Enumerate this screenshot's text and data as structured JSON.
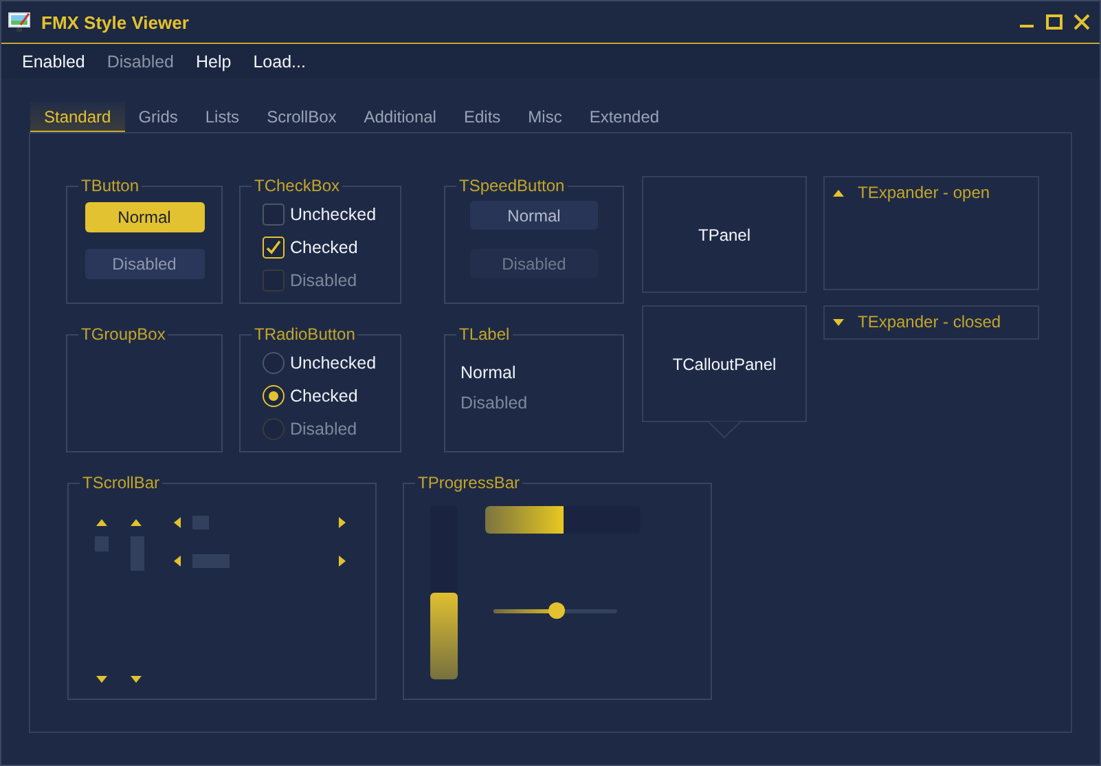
{
  "window": {
    "title": "FMX Style Viewer"
  },
  "menu": [
    {
      "label": "Enabled",
      "disabled": false
    },
    {
      "label": "Disabled",
      "disabled": true
    },
    {
      "label": "Help",
      "disabled": false
    },
    {
      "label": "Load...",
      "disabled": false
    }
  ],
  "tabs": [
    {
      "label": "Standard",
      "selected": true
    },
    {
      "label": "Grids",
      "selected": false
    },
    {
      "label": "Lists",
      "selected": false
    },
    {
      "label": "ScrollBox",
      "selected": false
    },
    {
      "label": "Additional",
      "selected": false
    },
    {
      "label": "Edits",
      "selected": false
    },
    {
      "label": "Misc",
      "selected": false
    },
    {
      "label": "Extended",
      "selected": false
    }
  ],
  "groups": [
    {
      "kind": "buttons",
      "title": "TButton",
      "items": [
        {
          "label": "Normal",
          "disabled": false
        },
        {
          "label": "Disabled",
          "disabled": true
        }
      ]
    },
    {
      "kind": "checkboxes",
      "title": "TCheckBox",
      "items": [
        {
          "label": "Unchecked",
          "checked": false,
          "disabled": false
        },
        {
          "label": "Checked",
          "checked": true,
          "disabled": false
        },
        {
          "label": "Disabled",
          "checked": false,
          "disabled": true
        }
      ]
    },
    {
      "kind": "speedbuttons",
      "title": "TSpeedButton",
      "items": [
        {
          "label": "Normal",
          "disabled": false
        },
        {
          "label": "Disabled",
          "disabled": true
        }
      ]
    },
    {
      "kind": "empty",
      "title": "TGroupBox"
    },
    {
      "kind": "radios",
      "title": "TRadioButton",
      "items": [
        {
          "label": "Unchecked",
          "selected": false,
          "disabled": false
        },
        {
          "label": "Checked",
          "selected": true,
          "disabled": false
        },
        {
          "label": "Disabled",
          "selected": false,
          "disabled": true
        }
      ]
    },
    {
      "kind": "labels",
      "title": "TLabel",
      "items": [
        {
          "label": "Normal",
          "disabled": false
        },
        {
          "label": "Disabled",
          "disabled": true
        }
      ]
    },
    {
      "kind": "scrollbars",
      "title": "TScrollBar"
    },
    {
      "kind": "progress",
      "title": "TProgressBar",
      "vertical": {
        "level": 0.5
      },
      "horizontal": {
        "level": 0.5
      },
      "slider": {
        "level": 0.51
      }
    }
  ],
  "panels": [
    {
      "kind": "panel",
      "label": "TPanel"
    },
    {
      "kind": "callout",
      "label": "TCalloutPanel"
    }
  ],
  "expanders": [
    {
      "label": "TExpander - open",
      "expanded": true
    },
    {
      "label": "TExpander - closed",
      "expanded": false
    }
  ]
}
